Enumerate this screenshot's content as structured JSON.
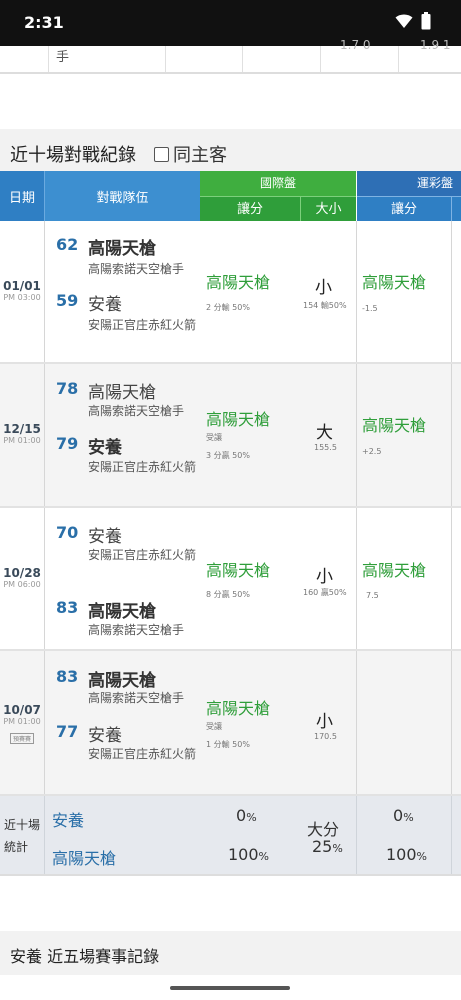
{
  "status_bar": {
    "time": "2:31"
  },
  "top_partial": {
    "hand_text": "手",
    "faded_1": "1.7 0",
    "faded_2": "1.9 1"
  },
  "section": {
    "title": "近十場對戰紀錄",
    "checkbox_label": "同主客",
    "checkbox_checked": false
  },
  "header": {
    "date": "日期",
    "teams": "對戰隊伍",
    "intl": "國際盤",
    "intl_handicap": "讓分",
    "intl_overunder": "大小",
    "lottery": "運彩盤",
    "lottery_handicap": "讓分"
  },
  "matches": [
    {
      "date": "01/01",
      "time": "PM 03:00",
      "tag": "",
      "team1": {
        "score": "62",
        "name": "高陽天槍",
        "sub": "高陽索諾天空槍手",
        "bold": true
      },
      "team2": {
        "score": "59",
        "name": "安養",
        "sub": "安陽正官庄赤紅火箭",
        "bold": false
      },
      "intl_pick": "高陽天槍",
      "intl_note1": "2 分輸 50%",
      "intl_note2": "",
      "ou": "小",
      "ou_note": "154 輸50%",
      "lottery_pick": "高陽天槍",
      "lottery_note": "-1.5"
    },
    {
      "date": "12/15",
      "time": "PM 01:00",
      "tag": "",
      "team1": {
        "score": "78",
        "name": "高陽天槍",
        "sub": "高陽索諾天空槍手",
        "bold": false
      },
      "team2": {
        "score": "79",
        "name": "安養",
        "sub": "安陽正官庄赤紅火箭",
        "bold": true
      },
      "intl_pick": "高陽天槍",
      "intl_note1": "受讓",
      "intl_note2": "3 分贏 50%",
      "ou": "大",
      "ou_note": "155.5",
      "lottery_pick": "高陽天槍",
      "lottery_note": "+2.5"
    },
    {
      "date": "10/28",
      "time": "PM 06:00",
      "tag": "",
      "team1": {
        "score": "70",
        "name": "安養",
        "sub": "安陽正官庄赤紅火箭",
        "bold": false
      },
      "team2": {
        "score": "83",
        "name": "高陽天槍",
        "sub": "高陽索諾天空槍手",
        "bold": true
      },
      "intl_pick": "高陽天槍",
      "intl_note1": "8 分贏 50%",
      "intl_note2": "",
      "ou": "小",
      "ou_note": "160 贏50%",
      "lottery_pick": "高陽天槍",
      "lottery_note": "7.5"
    },
    {
      "date": "10/07",
      "time": "PM 01:00",
      "tag": "預賽賽",
      "team1": {
        "score": "83",
        "name": "高陽天槍",
        "sub": "高陽索諾天空槍手",
        "bold": true
      },
      "team2": {
        "score": "77",
        "name": "安養",
        "sub": "安陽正官庄赤紅火箭",
        "bold": false
      },
      "intl_pick": "高陽天槍",
      "intl_note1": "受讓",
      "intl_note2": "1 分輸 50%",
      "ou": "小",
      "ou_note": "170.5",
      "lottery_pick": "",
      "lottery_note": ""
    }
  ],
  "summary": {
    "label_line1": "近十場",
    "label_line2": "統計",
    "team1": "安養",
    "team2": "高陽天槍",
    "intl_team1_pct": "0",
    "intl_team2_pct": "100",
    "ou_label": "大分",
    "ou_pct": "25",
    "lottery_team1_pct": "0",
    "lottery_team2_pct": "100",
    "pct_sign": "%"
  },
  "bottom_section": {
    "title": "安養 近五場賽事記錄"
  },
  "colors": {
    "intl_green": "#3fae3f",
    "header_blue": "#2f7fc4",
    "pick_green": "#2f9e3a",
    "score_blue": "#2a6fa8"
  }
}
